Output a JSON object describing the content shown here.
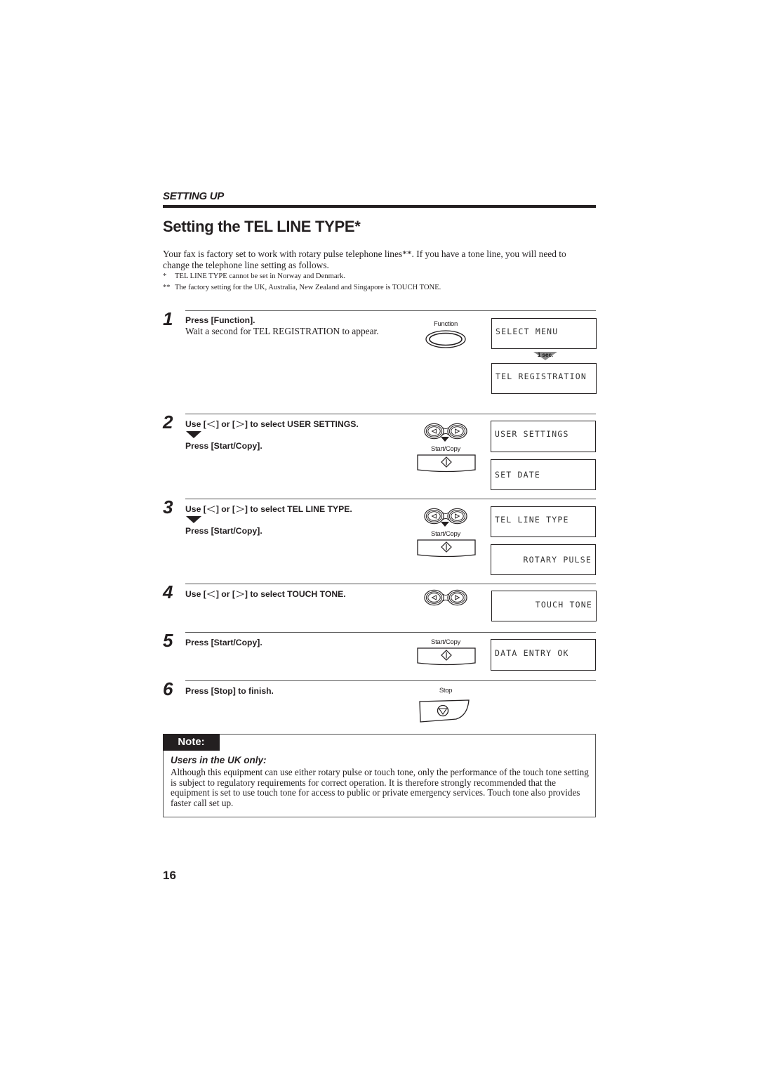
{
  "header": {
    "section_label": "SETTING UP",
    "title": "Setting the TEL LINE TYPE*"
  },
  "intro": {
    "paragraph": "Your fax is factory set to work with rotary pulse telephone lines**. If you have a tone line, you will need to change the telephone line setting as follows.",
    "footnotes": [
      {
        "mark": "*",
        "text": "TEL LINE TYPE cannot be set in Norway and Denmark."
      },
      {
        "mark": "**",
        "text": "The factory setting for the UK, Australia, New Zealand and Singapore is TOUCH TONE."
      }
    ]
  },
  "steps": [
    {
      "number": "1",
      "instruction": "Press [Function].",
      "detail": "Wait a second for TEL REGISTRATION to appear.",
      "button_caption": "Function",
      "displays": [
        "SELECT MENU",
        "TEL REGISTRATION"
      ],
      "delay_label": "1 sec."
    },
    {
      "number": "2",
      "instruction_prefix": "Use [",
      "instruction_mid": "] or [",
      "instruction_suffix": "] to select USER SETTINGS.",
      "then": "Press [Start/Copy].",
      "button_caption": "Start/Copy",
      "displays": [
        "USER SETTINGS",
        "SET DATE"
      ]
    },
    {
      "number": "3",
      "instruction_prefix": "Use [",
      "instruction_mid": "] or [",
      "instruction_suffix": "] to select TEL LINE TYPE.",
      "then": "Press [Start/Copy].",
      "button_caption": "Start/Copy",
      "displays": [
        "TEL LINE TYPE",
        "ROTARY PULSE"
      ]
    },
    {
      "number": "4",
      "instruction_prefix": "Use [",
      "instruction_mid": "] or [",
      "instruction_suffix": "] to select TOUCH TONE.",
      "displays": [
        "TOUCH TONE"
      ]
    },
    {
      "number": "5",
      "instruction": "Press [Start/Copy].",
      "button_caption": "Start/Copy",
      "displays": [
        "DATA ENTRY OK"
      ]
    },
    {
      "number": "6",
      "instruction": "Press [Stop] to finish.",
      "button_caption": "Stop"
    }
  ],
  "note": {
    "tab_label": "Note:",
    "heading": "Users in the UK only:",
    "body": "Although this equipment can use either rotary pulse or touch tone, only the performance of the touch tone setting is subject to regulatory requirements for correct operation. It is therefore strongly recommended that the equipment is set to use touch tone for access to public or private emergency services. Touch tone also provides faster call set up."
  },
  "page_number": "16"
}
